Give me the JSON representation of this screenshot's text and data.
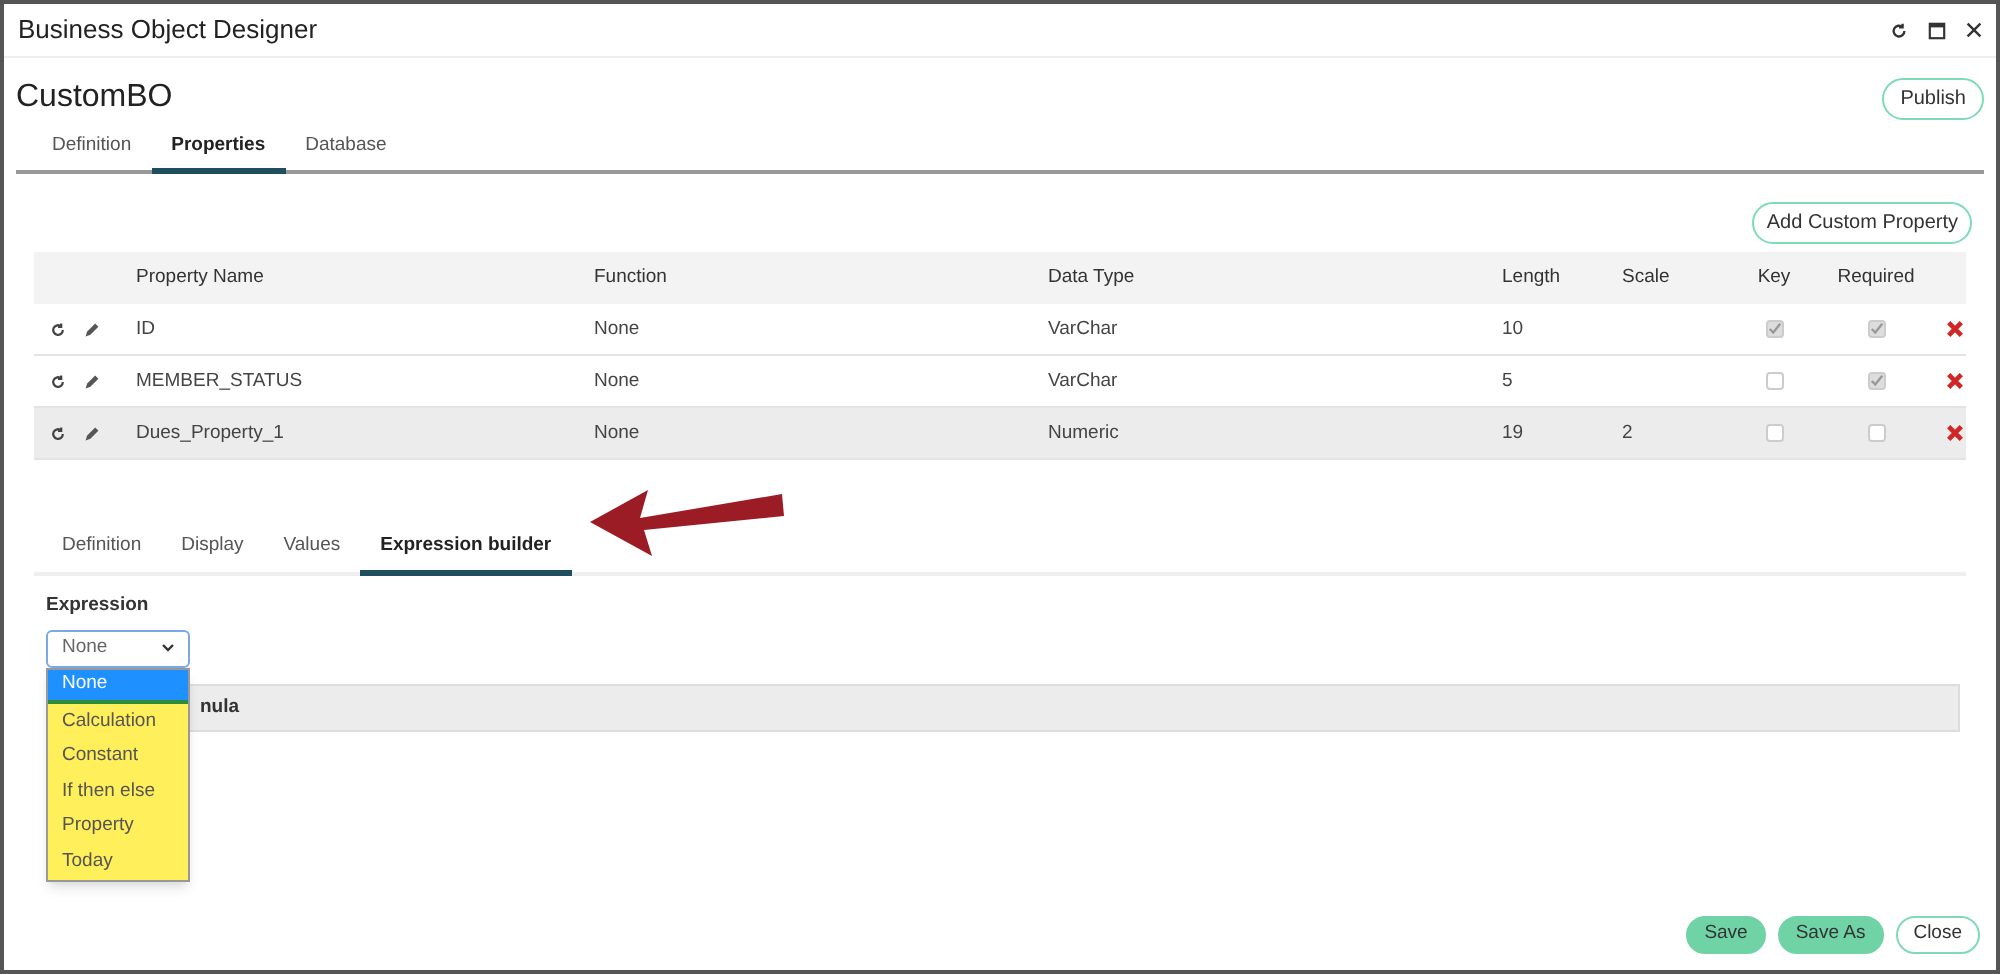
{
  "window": {
    "title": "Business Object Designer"
  },
  "header": {
    "title": "CustomBO",
    "publish_button": "Publish"
  },
  "tabs": [
    {
      "label": "Definition",
      "selected": false
    },
    {
      "label": "Properties",
      "selected": true
    },
    {
      "label": "Database",
      "selected": false
    }
  ],
  "add_button": "Add Custom Property",
  "table": {
    "columns": [
      "Property Name",
      "Function",
      "Data Type",
      "Length",
      "Scale",
      "Key",
      "Required"
    ],
    "rows": [
      {
        "name": "ID",
        "function": "None",
        "data_type": "VarChar",
        "length": "10",
        "scale": "",
        "key": true,
        "required": true,
        "selected": false
      },
      {
        "name": "MEMBER_STATUS",
        "function": "None",
        "data_type": "VarChar",
        "length": "5",
        "key": false,
        "required": true,
        "selected": false
      },
      {
        "name": "Dues_Property_1",
        "function": "None",
        "data_type": "Numeric",
        "length": "19",
        "scale": "2",
        "key": false,
        "required": false,
        "selected": true
      }
    ]
  },
  "detail_tabs": [
    {
      "label": "Definition",
      "selected": false
    },
    {
      "label": "Display",
      "selected": false
    },
    {
      "label": "Values",
      "selected": false
    },
    {
      "label": "Expression builder",
      "selected": true
    }
  ],
  "expression": {
    "label": "Expression",
    "value": "None",
    "options": [
      {
        "label": "None",
        "selected": true
      },
      {
        "label": "Calculation",
        "selected": false
      },
      {
        "label": "Constant",
        "selected": false
      },
      {
        "label": "If then else",
        "selected": false
      },
      {
        "label": "Property",
        "selected": false
      },
      {
        "label": "Today",
        "selected": false
      }
    ],
    "formula_header": "nula"
  },
  "footer_buttons": [
    {
      "label": "Save",
      "kind": "primary"
    },
    {
      "label": "Save As",
      "kind": "primary"
    },
    {
      "label": "Close",
      "kind": "outline"
    }
  ]
}
